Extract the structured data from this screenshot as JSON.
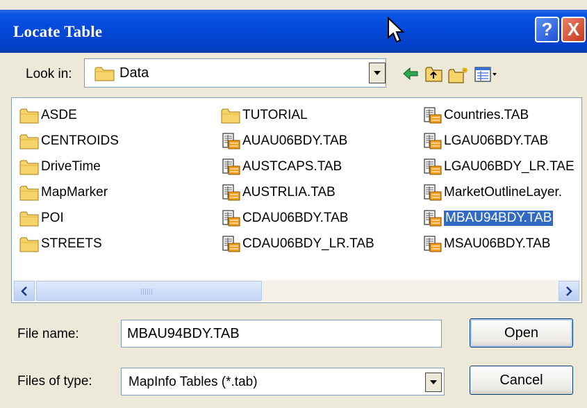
{
  "window": {
    "title": "Locate Table",
    "help_label": "?",
    "close_label": "X"
  },
  "lookin": {
    "label": "Look in:",
    "value": "Data"
  },
  "toolbar": [
    "back-icon",
    "up-folder-icon",
    "new-folder-icon",
    "view-menu-icon"
  ],
  "files": {
    "col1": [
      {
        "name": "ASDE",
        "type": "folder"
      },
      {
        "name": "CENTROIDS",
        "type": "folder"
      },
      {
        "name": "DriveTime",
        "type": "folder"
      },
      {
        "name": "MapMarker",
        "type": "folder"
      },
      {
        "name": "POI",
        "type": "folder"
      },
      {
        "name": "STREETS",
        "type": "folder"
      }
    ],
    "col2": [
      {
        "name": "TUTORIAL",
        "type": "folder"
      },
      {
        "name": "AUAU06BDY.TAB",
        "type": "tab"
      },
      {
        "name": "AUSTCAPS.TAB",
        "type": "tab"
      },
      {
        "name": "AUSTRLIA.TAB",
        "type": "tab"
      },
      {
        "name": "CDAU06BDY.TAB",
        "type": "tab"
      },
      {
        "name": "CDAU06BDY_LR.TAB",
        "type": "tab"
      }
    ],
    "col3": [
      {
        "name": "Countries.TAB",
        "type": "tab"
      },
      {
        "name": "LGAU06BDY.TAB",
        "type": "tab"
      },
      {
        "name": "LGAU06BDY_LR.TAE",
        "type": "tab"
      },
      {
        "name": "MarketOutlineLayer.",
        "type": "tab"
      },
      {
        "name": "MBAU94BDY.TAB",
        "type": "tab",
        "selected": true
      },
      {
        "name": "MSAU06BDY.TAB",
        "type": "tab"
      }
    ]
  },
  "filename": {
    "label": "File name:",
    "value": "MBAU94BDY.TAB"
  },
  "filetype": {
    "label": "Files of type:",
    "value": "MapInfo Tables (*.tab)"
  },
  "buttons": {
    "open": "Open",
    "cancel": "Cancel"
  },
  "colors": {
    "titlebar": "#0447d6",
    "selection": "#316ac5",
    "folder": "#f7d36b"
  }
}
